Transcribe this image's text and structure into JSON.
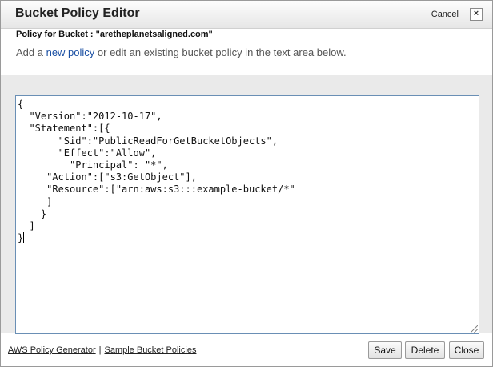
{
  "dialog": {
    "title": "Bucket Policy Editor",
    "cancel_label": "Cancel",
    "close_glyph": "×",
    "policy_for": "Policy for Bucket : \"aretheplanetsaligned.com\"",
    "intro_before": "Add a ",
    "intro_link": "new policy",
    "intro_after": " or edit an existing bucket policy in the text area below."
  },
  "editor": {
    "lines": [
      "{",
      "  \"Version\":\"2012-10-17\",",
      "  \"Statement\":[{",
      "       \"Sid\":\"PublicReadForGetBucketObjects\",",
      "       \"Effect\":\"Allow\",",
      "         \"Principal\": \"*\",",
      "     \"Action\":[\"s3:GetObject\"],",
      "     \"Resource\":[\"arn:aws:s3:::example-bucket/*\"",
      "     ]",
      "    }",
      "  ]",
      "}"
    ]
  },
  "footer": {
    "link_generator": "AWS Policy Generator",
    "separator": "|",
    "link_samples": "Sample Bucket Policies",
    "save_label": "Save",
    "delete_label": "Delete",
    "close_label": "Close"
  }
}
